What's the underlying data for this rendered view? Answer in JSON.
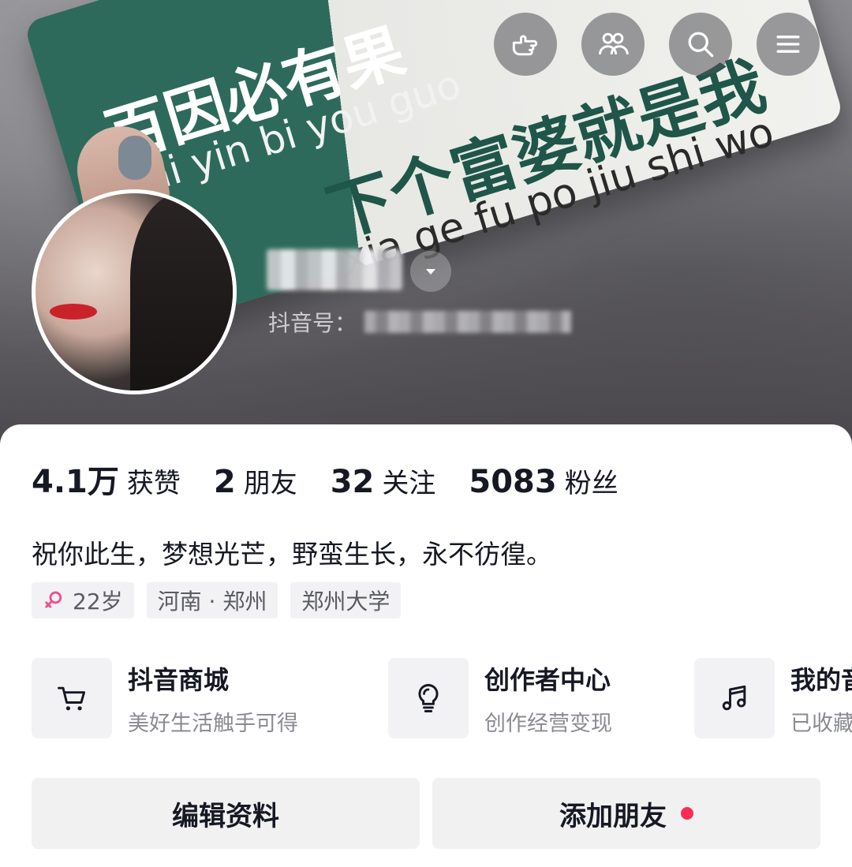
{
  "header": {
    "banner_text": {
      "line1": "百因必有果",
      "line1_pinyin": "bai yin bi you guo",
      "line2": "下个富婆就是我",
      "line2_pinyin": "xia ge fu po jiu shi wo"
    },
    "top_buttons": [
      "hand-pointer-icon",
      "friends-icon",
      "search-icon",
      "menu-icon"
    ]
  },
  "profile": {
    "douyin_id_label": "抖音号："
  },
  "stats": [
    {
      "value": "4.1万",
      "label": "获赞"
    },
    {
      "value": "2",
      "label": "朋友"
    },
    {
      "value": "32",
      "label": "关注"
    },
    {
      "value": "5083",
      "label": "粉丝"
    }
  ],
  "bio": "祝你此生，梦想光芒，野蛮生长，永不彷徨。",
  "tags": {
    "age": "22岁",
    "location": "河南 · 郑州",
    "school": "郑州大学"
  },
  "services": [
    {
      "title": "抖音商城",
      "subtitle": "美好生活触手可得",
      "icon": "cart-icon"
    },
    {
      "title": "创作者中心",
      "subtitle": "创作经营变现",
      "icon": "lightbulb-icon"
    },
    {
      "title": "我的音乐",
      "subtitle": "已收藏",
      "icon": "music-note-icon"
    }
  ],
  "actions": {
    "edit_profile": "编辑资料",
    "add_friend": "添加朋友"
  },
  "colors": {
    "accent_red": "#fe2c55",
    "text_primary": "#161823",
    "text_secondary": "#8a8b91",
    "chip_bg": "#f2f2f4"
  }
}
